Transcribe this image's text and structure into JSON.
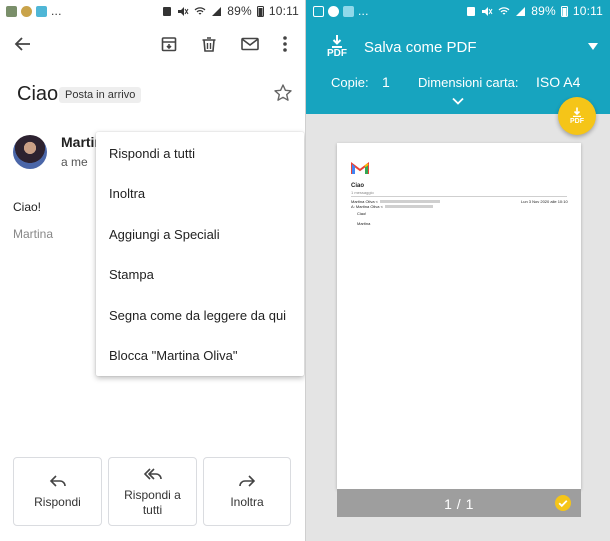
{
  "left": {
    "status": {
      "battery": "89%",
      "time": "10:11"
    },
    "email": {
      "subject": "Ciao",
      "label": "Posta in arrivo",
      "sender": "Martina Oliva",
      "to_me": "a me",
      "body": "Ciao!",
      "signature": "Martina"
    },
    "menu": {
      "items": [
        "Rispondi a tutti",
        "Inoltra",
        "Aggiungi a Speciali",
        "Stampa",
        "Segna come da leggere da qui",
        "Blocca \"Martina Oliva\""
      ]
    },
    "actions": {
      "reply": "Rispondi",
      "reply_all_line1": "Rispondi a",
      "reply_all_line2": "tutti",
      "forward": "Inoltra"
    }
  },
  "right": {
    "status": {
      "battery": "89%",
      "time": "10:11"
    },
    "pdf_label": "PDF",
    "destination": "Salva come PDF",
    "copies_label": "Copie:",
    "copies_value": "1",
    "paper_label": "Dimensioni carta:",
    "paper_value": "ISO A4",
    "fab_label": "PDF",
    "preview": {
      "title": "Ciao",
      "count": "1 messaggio",
      "sender_name": "Martina Oliva <",
      "date": "Lun 3 Nov 2020 alle 10:10",
      "to": "A: Martina Oliva <",
      "body": "Ciao!",
      "signature": "Martina"
    },
    "page_indicator": "1 / 1"
  },
  "colors": {
    "accent": "#17a4bf",
    "fab": "#f5c518"
  }
}
